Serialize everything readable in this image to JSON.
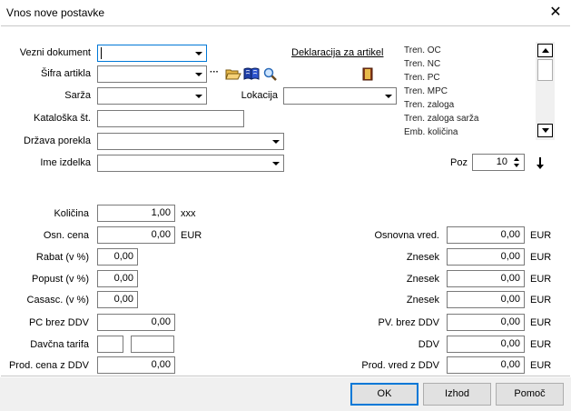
{
  "window": {
    "title": "Vnos nove postavke",
    "close_glyph": "✕"
  },
  "fields": {
    "vezni_dokument": {
      "label": "Vezni dokument",
      "value": ""
    },
    "sifra_artikla": {
      "label": "Šifra artikla",
      "value": "",
      "more_glyph": "···"
    },
    "sarza": {
      "label": "Sarža",
      "value": ""
    },
    "lokacija": {
      "label": "Lokacija",
      "value": ""
    },
    "kataloska": {
      "label": "Kataloška št.",
      "value": ""
    },
    "drzava": {
      "label": "Država porekla",
      "value": ""
    },
    "ime_izdelka": {
      "label": "Ime izdelka",
      "value": ""
    }
  },
  "deklaracija_link": "Deklaracija za artikel",
  "info_list": [
    "Tren. OC",
    "Tren. NC",
    "Tren. PC",
    "Tren. MPC",
    "Tren. zaloga",
    "Tren. zaloga sarža",
    "Emb. količina"
  ],
  "poz": {
    "label": "Poz",
    "value": "10"
  },
  "pricing_left": [
    {
      "label": "Količina",
      "value": "1,00",
      "unit": "xxx"
    },
    {
      "label": "Osn. cena",
      "value": "0,00",
      "unit": "EUR"
    },
    {
      "label": "Rabat (v %)",
      "value": "0,00",
      "unit": ""
    },
    {
      "label": "Popust (v %)",
      "value": "0,00",
      "unit": ""
    },
    {
      "label": "Casasc. (v %)",
      "value": "0,00",
      "unit": ""
    },
    {
      "label": "PC brez DDV",
      "value": "0,00",
      "unit": ""
    },
    {
      "label": "Davčna tarifa",
      "value": "",
      "value2": ""
    },
    {
      "label": "Prod. cena z DDV",
      "value": "0,00",
      "unit": ""
    }
  ],
  "pricing_right": [
    {
      "label": "Osnovna vred.",
      "value": "0,00",
      "unit": "EUR"
    },
    {
      "label": "Znesek",
      "value": "0,00",
      "unit": "EUR"
    },
    {
      "label": "Znesek",
      "value": "0,00",
      "unit": "EUR"
    },
    {
      "label": "Znesek",
      "value": "0,00",
      "unit": "EUR"
    },
    {
      "label": "PV. brez DDV",
      "value": "0,00",
      "unit": "EUR"
    },
    {
      "label": "DDV",
      "value": "0,00",
      "unit": "EUR"
    },
    {
      "label": "Prod. vred z DDV",
      "value": "0,00",
      "unit": "EUR"
    }
  ],
  "buttons": {
    "ok": "OK",
    "izhod": "Izhod",
    "pomoc": "Pomoč"
  },
  "icons": {
    "folder": "open-folder-icon",
    "book": "book-icon",
    "magnifier": "magnifier-icon",
    "declaration": "declaration-book-icon",
    "arrow": "down-arrow-icon"
  },
  "colors": {
    "focus_border": "#0078d7",
    "book_blue": "#1f3fa8",
    "book_brown": "#8b3a1a",
    "folder_yellow": "#e8b94a"
  }
}
